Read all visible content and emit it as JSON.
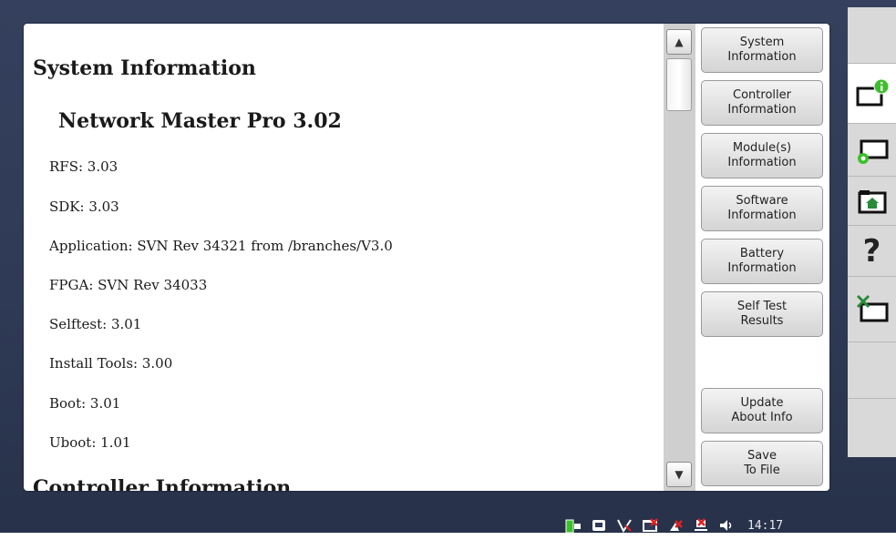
{
  "content": {
    "title": "System Information",
    "subtitle": "Network Master Pro 3.02",
    "rows": [
      "RFS: 3.03",
      "SDK: 3.03",
      "Application: SVN Rev 34321 from /branches/V3.0",
      "FPGA: SVN Rev 34033",
      "Selftest: 3.01",
      "Install Tools: 3.00",
      "Boot: 3.01",
      "Uboot: 1.01"
    ],
    "next_heading": "Controller Information"
  },
  "scrollbar": {
    "up_icon": "triangle-up-icon",
    "down_icon": "triangle-down-icon",
    "up_glyph": "▲",
    "down_glyph": "▼"
  },
  "panel": {
    "buttons": [
      "System\nInformation",
      "Controller\nInformation",
      "Module(s)\nInformation",
      "Software\nInformation",
      "Battery\nInformation",
      "Self Test\nResults",
      "Update\nAbout Info",
      "Save\nTo File"
    ]
  },
  "sidebar": {
    "help_glyph": "?"
  },
  "statusbar": {
    "time": "14:17"
  },
  "colors": {
    "background": "#2f3a56",
    "accent_green": "#3bbf2a",
    "error_red": "#e02020"
  }
}
